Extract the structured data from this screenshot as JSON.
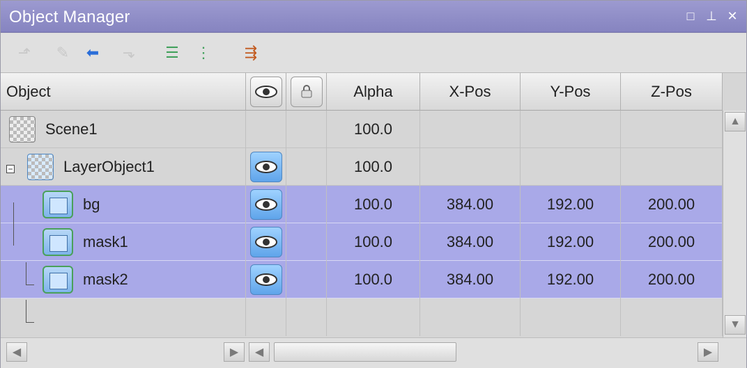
{
  "window": {
    "title": "Object Manager",
    "buttons": [
      "maximize-button",
      "pin-button",
      "close-button"
    ]
  },
  "toolbar": {
    "icons": [
      "move-up-icon",
      "edit-icon",
      "back-icon",
      "move-down-icon",
      "tree-icon",
      "list-icon",
      "merge-icon"
    ]
  },
  "columns": {
    "object": "Object",
    "visible_icon": "eye-icon",
    "lock_icon": "lock-icon",
    "alpha": "Alpha",
    "xpos": "X-Pos",
    "ypos": "Y-Pos",
    "zpos": "Z-Pos"
  },
  "rows": [
    {
      "name": "Scene1",
      "alpha": "100.0",
      "x": "",
      "y": "",
      "z": "",
      "visible": false,
      "type": "scene",
      "selected": false
    },
    {
      "name": "LayerObject1",
      "alpha": "100.0",
      "x": "",
      "y": "",
      "z": "",
      "visible": true,
      "type": "layer",
      "selected": false
    },
    {
      "name": "bg",
      "alpha": "100.0",
      "x": "384.00",
      "y": "192.00",
      "z": "200.00",
      "visible": true,
      "type": "object",
      "selected": true
    },
    {
      "name": "mask1",
      "alpha": "100.0",
      "x": "384.00",
      "y": "192.00",
      "z": "200.00",
      "visible": true,
      "type": "object",
      "selected": true
    },
    {
      "name": "mask2",
      "alpha": "100.0",
      "x": "384.00",
      "y": "192.00",
      "z": "200.00",
      "visible": true,
      "type": "object",
      "selected": true
    }
  ]
}
